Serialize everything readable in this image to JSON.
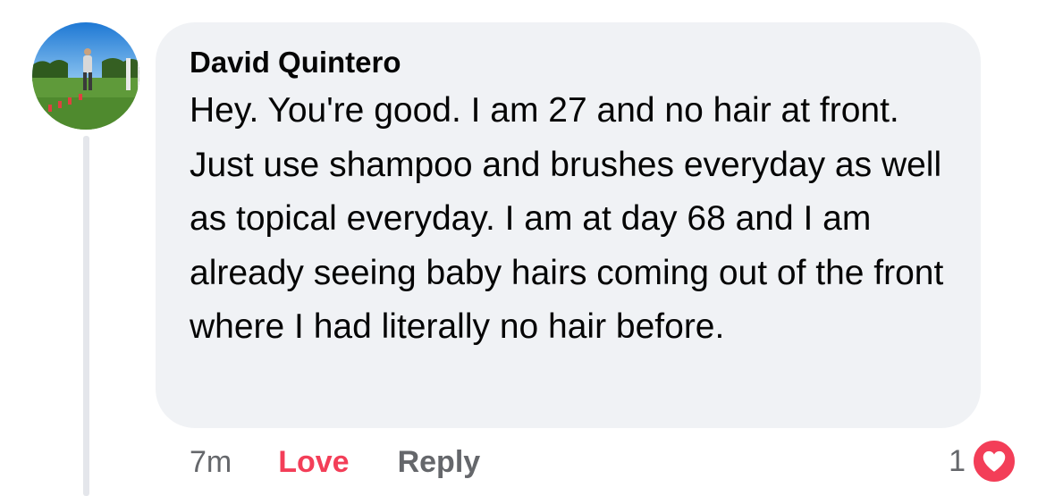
{
  "comment": {
    "author": "David Quintero",
    "text": "Hey. You're good. I am 27 and no hair at front. Just use shampoo and brushes everyday as well as topical everyday. I am at day 68 and I am already seeing baby hairs coming out of the front where I had literally no hair before.",
    "timestamp": "7m",
    "love_label": "Love",
    "reply_label": "Reply",
    "reaction_count": "1",
    "reaction_icon": "heart-icon"
  },
  "colors": {
    "bubble_background": "#f0f2f5",
    "love_accent": "#f33e58",
    "secondary_text": "#65676b",
    "primary_text": "#050505"
  }
}
